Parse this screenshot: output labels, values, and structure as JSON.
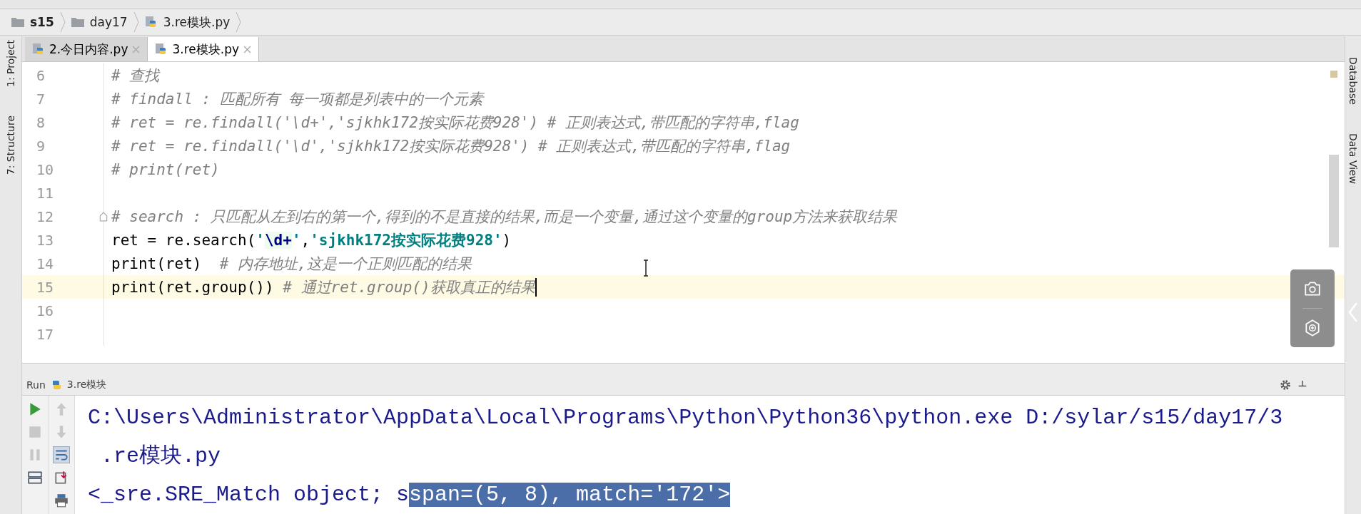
{
  "breadcrumbs": [
    {
      "label": "s15",
      "kind": "folder",
      "bold": true
    },
    {
      "label": "day17",
      "kind": "folder",
      "bold": false
    },
    {
      "label": "3.re模块.py",
      "kind": "python",
      "bold": false
    }
  ],
  "tabs": [
    {
      "label": "2.今日内容.py",
      "selected": false
    },
    {
      "label": "3.re模块.py",
      "selected": true
    }
  ],
  "left_stripe": [
    "1: Project",
    "7: Structure"
  ],
  "right_stripe": [
    "Database",
    "Data View"
  ],
  "editor": {
    "lines": [
      {
        "number": "6",
        "current": false,
        "fold": false,
        "caret": false,
        "segments": [
          {
            "kind": "comment",
            "text": "# 查找"
          }
        ]
      },
      {
        "number": "7",
        "current": false,
        "fold": false,
        "caret": false,
        "segments": [
          {
            "kind": "comment",
            "text": "# findall : 匹配所有 每一项都是列表中的一个元素"
          }
        ]
      },
      {
        "number": "8",
        "current": false,
        "fold": false,
        "caret": false,
        "segments": [
          {
            "kind": "comment",
            "text": "# ret = re.findall('\\d+','sjkhk172按实际花费928') # 正则表达式,带匹配的字符串,flag"
          }
        ]
      },
      {
        "number": "9",
        "current": false,
        "fold": false,
        "caret": false,
        "segments": [
          {
            "kind": "comment",
            "text": "# ret = re.findall('\\d','sjkhk172按实际花费928') # 正则表达式,带匹配的字符串,flag"
          }
        ]
      },
      {
        "number": "10",
        "current": false,
        "fold": false,
        "caret": false,
        "segments": [
          {
            "kind": "comment",
            "text": "# print(ret)"
          }
        ]
      },
      {
        "number": "11",
        "current": false,
        "fold": false,
        "caret": false
      },
      {
        "number": "12",
        "current": false,
        "fold": true,
        "caret": false,
        "segments": [
          {
            "kind": "comment",
            "text": "# search : 只匹配从左到右的第一个,得到的不是直接的结果,而是一个变量,通过这个变量的group方法来获取结果"
          }
        ]
      },
      {
        "number": "13",
        "current": false,
        "fold": false,
        "caret": false,
        "segments": [
          {
            "kind": "plain",
            "text": "ret = re.search("
          },
          {
            "kind": "string",
            "text": "'"
          },
          {
            "kind": "escape",
            "text": "\\d+"
          },
          {
            "kind": "string",
            "text": "'"
          },
          {
            "kind": "plain",
            "text": ","
          },
          {
            "kind": "string",
            "text": "'sjkhk172按实际花费928'"
          },
          {
            "kind": "plain",
            "text": ")"
          }
        ]
      },
      {
        "number": "14",
        "current": false,
        "fold": false,
        "caret": false,
        "segments": [
          {
            "kind": "plain",
            "text": "print(ret)  "
          },
          {
            "kind": "comment",
            "text": "# 内存地址,这是一个正则匹配的结果"
          }
        ]
      },
      {
        "number": "15",
        "current": true,
        "fold": false,
        "caret": true,
        "segments": [
          {
            "kind": "plain",
            "text": "print(ret.group())"
          },
          {
            "kind": "comment",
            "text": " # 通过ret.group()获取真正的结果"
          }
        ]
      },
      {
        "number": "16",
        "current": false,
        "fold": false,
        "caret": false
      },
      {
        "number": "17",
        "current": false,
        "fold": false,
        "caret": false
      }
    ]
  },
  "run": {
    "title": "Run",
    "config": "3.re模块",
    "output": [
      {
        "segments": [
          {
            "text": "C:\\Users\\Administrator\\AppData\\Local\\Programs\\Python\\Python36\\python.exe D:/sylar/s15/day17/3",
            "selected": false
          }
        ]
      },
      {
        "segments": [
          {
            "text": " .re模块.py",
            "selected": false
          }
        ]
      },
      {
        "segments": [
          {
            "text": "<_sre.SRE_Match object; s",
            "selected": false
          },
          {
            "text": "span=(5, 8), match='172'>",
            "selected": true
          }
        ]
      }
    ]
  }
}
